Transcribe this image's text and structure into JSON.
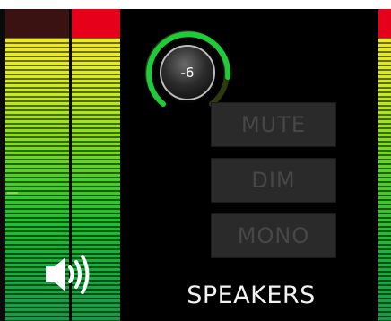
{
  "channel": {
    "label": "SPEAKERS",
    "volume_value": "-6",
    "volume_level_fraction": 0.72
  },
  "buttons": {
    "mute_label": "MUTE",
    "dim_label": "DIM",
    "mono_label": "MONO"
  },
  "meters": {
    "left_clip_active": false,
    "right_clip_active": true,
    "colors": {
      "clip_red": "#e6001a",
      "clip_dark": "#3a1212",
      "meter_yellow": "#f2e81a",
      "meter_green": "#22c42a",
      "knob_arc_green": "#1ecc3a"
    }
  },
  "icons": {
    "speaker": "speaker-volume-icon"
  }
}
